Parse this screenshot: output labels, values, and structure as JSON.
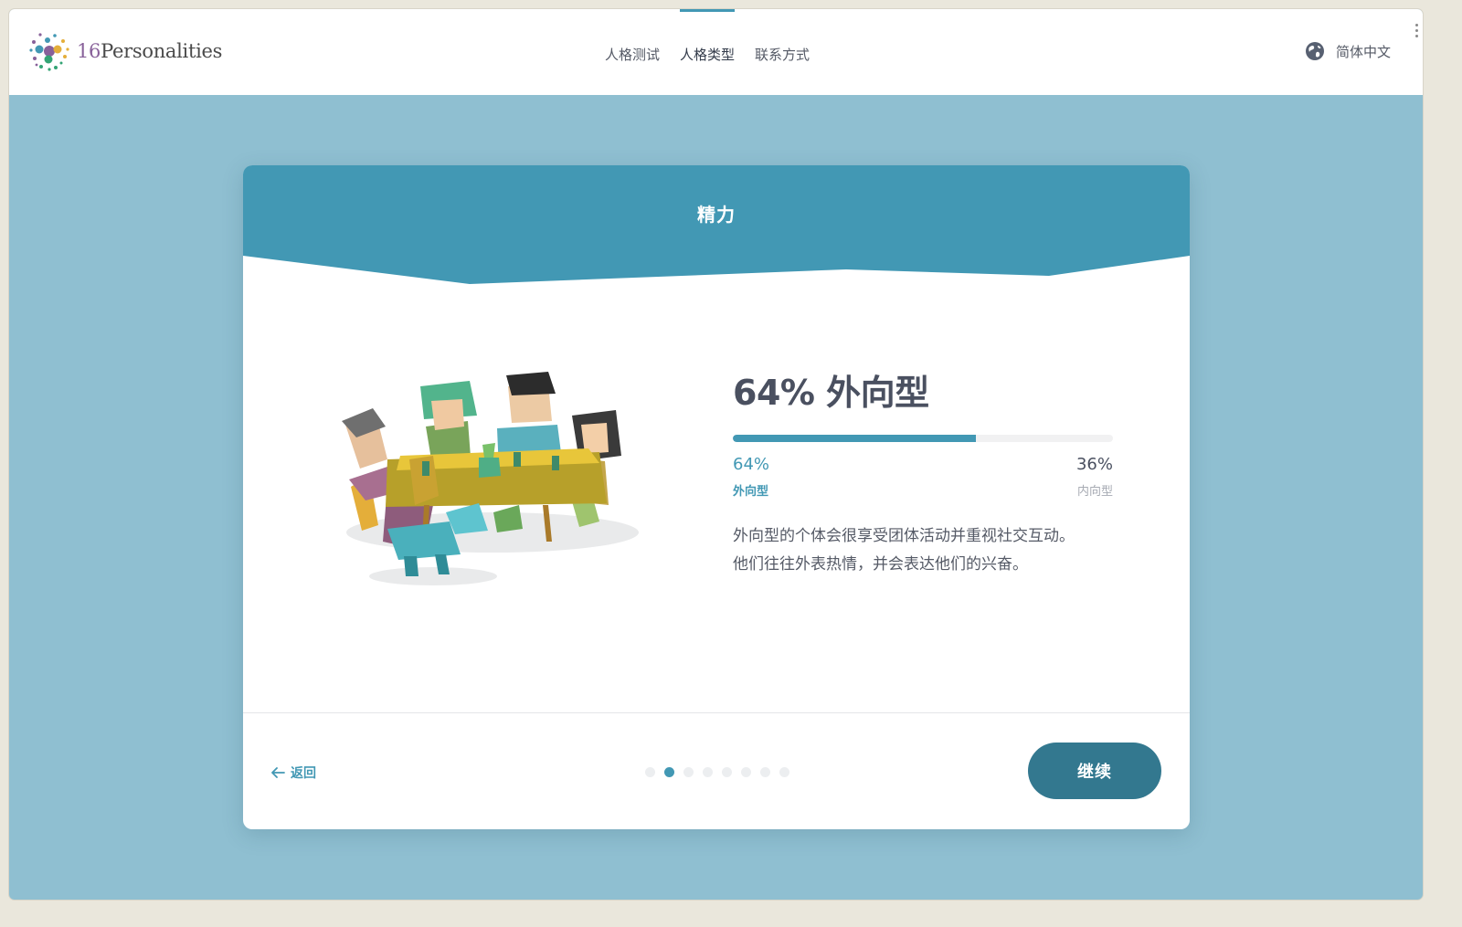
{
  "header": {
    "brand": {
      "number": "16",
      "name": "Personalities"
    },
    "nav": [
      {
        "label": "人格测试",
        "active": false
      },
      {
        "label": "人格类型",
        "active": true
      },
      {
        "label": "联系方式",
        "active": false
      }
    ],
    "language": "简体中文",
    "icons": {
      "logo": "16p-dots-logo",
      "language": "globe-icon"
    }
  },
  "card": {
    "title": "精力",
    "result_title": "64% 外向型",
    "progress": {
      "left_percent": 64,
      "right_percent": 36
    },
    "left_pct_label": "64%",
    "left_trait": "外向型",
    "right_pct_label": "36%",
    "right_trait": "内向型",
    "description_line1": "外向型的个体会很享受团体活动并重视社交互动。",
    "description_line2": "他们往往外表热情，并会表达他们的兴奋。",
    "back_label": "返回",
    "continue_label": "继续",
    "pagination": {
      "total": 8,
      "current": 2
    }
  },
  "colors": {
    "background": "#8fbfd1",
    "accent": "#4298b4",
    "button": "#33788f",
    "heading": "#4a5060"
  }
}
